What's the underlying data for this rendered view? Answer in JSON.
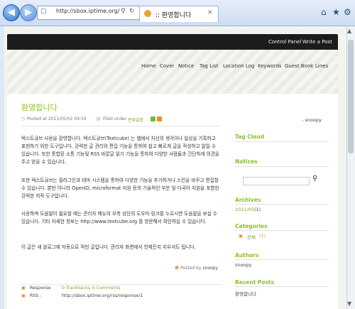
{
  "browser": {
    "url": "http://sbox.iptime.org/",
    "tab_title": ":: 환영합니다"
  },
  "topbar": {
    "control_panel": "Control Panel",
    "write_post": "Write a Post"
  },
  "menu": [
    "Home",
    "Cover",
    "Notice",
    "Tag List",
    "Location Log",
    "Keywords",
    "Guest Book",
    "Lines"
  ],
  "post": {
    "title": "환영합니다",
    "posted_at": "Posted at 2011/05/02 04:59",
    "filed_under_label": "Filed under",
    "category": "분류없음",
    "paragraphs": [
      "텍스트큐브 사용을 환영합니다. 텍스트큐브(Textcube) 는 웹에서 자신의 생각이나 일상을 기록하고 표현하기 위한 도구입니다. 강력한 글 관리와 편집 기능을 통하여 쉽고 빠르게 글을 작성하고 알릴 수 있습니다. 또한 통합된 소통 기능및 RSS 바깥글 읽기 기능을 통하여 다양한 사람들과 간단하게 의견을 주고 받을 수 있습니다.",
      "또한 텍스트큐브는 플러그인과 테마 시스템을 통하여 다양한 기능을 추가하거나 스킨을 바꾸고 편집할 수 있습니다. 뿐만 아니라 OpenID, microformat 지원 등의 기술적인 부분 및 다국어 지원을 포함한 강력한 저작 도구입니다.",
      "사용하며 도움말이 필요할 때는 관리자 메뉴의 우측 상단의 도우미 링크를 누르시면 도움말을 보실 수 있습니다. 기타 자세한 정보는 http://www.textcube.org 를 방문해서 확인하실 수 있습니다.",
      "이 글은 새 블로그에 자동으로 적힌 글입니다. 관리자 화면에서 언제든지 지우셔도 됩니다."
    ],
    "posted_by_label": "Posted by",
    "author": "snoopy",
    "response_label": "Response",
    "trackbacks": "0 Trackbacks",
    "comments": "0 Comments",
    "rss_label": "RSS :",
    "rss_url": "http://sbox.iptime.org/rss/response/1"
  },
  "sidebar": {
    "blog_owner": "- snoopy",
    "tag_cloud": "Tag Cloud",
    "notices": "Notices",
    "archives": "Archives",
    "archive_item": "2011/05",
    "archive_count": "(1)",
    "categories": "Categories",
    "category_all": "전체",
    "category_count": "(1)",
    "authors": "Authors",
    "author_name": "snoopy",
    "recent_posts": "Recent Posts",
    "recent_item": "환영합니다"
  }
}
